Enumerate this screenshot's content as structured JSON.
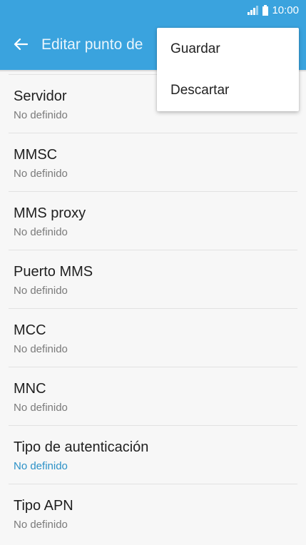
{
  "status_bar": {
    "time": "10:00",
    "icons": [
      "signal-icon",
      "battery-icon"
    ]
  },
  "app_bar": {
    "back_icon": "arrow-left-icon",
    "title": "Editar punto de"
  },
  "overflow_menu": {
    "items": [
      {
        "label": "Guardar"
      },
      {
        "label": "Descartar"
      }
    ]
  },
  "settings": {
    "items": [
      {
        "title": "Servidor",
        "value": "No definido"
      },
      {
        "title": "MMSC",
        "value": "No definido"
      },
      {
        "title": "MMS proxy",
        "value": "No definido"
      },
      {
        "title": "Puerto MMS",
        "value": "No definido"
      },
      {
        "title": "MCC",
        "value": "No definido"
      },
      {
        "title": "MNC",
        "value": "No definido"
      },
      {
        "title": "Tipo de autenticación",
        "value": "No definido"
      },
      {
        "title": "Tipo APN",
        "value": "No definido"
      }
    ]
  },
  "colors": {
    "app_bar": "#3aa3de",
    "accent_value": "#2b91c7",
    "background": "#f7f7f7"
  }
}
